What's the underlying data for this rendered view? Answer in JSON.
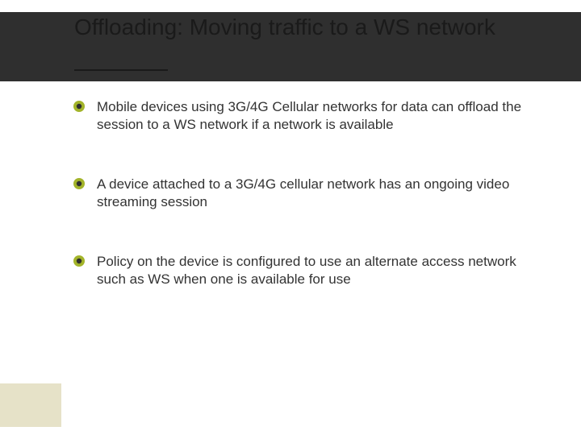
{
  "title": "Offloading: Moving traffic to a WS network",
  "bullets": [
    "Mobile devices using 3G/4G Cellular networks for data can offload the session to a WS network if a network is available",
    "A device attached to a 3G/4G cellular network has an ongoing video streaming session",
    "Policy on the device is configured to use an alternate access network such as WS when one is available for use"
  ],
  "colors": {
    "accent": "#a3b42a",
    "header": "#2f2f2f",
    "footer_block": "#e6e2c8"
  }
}
